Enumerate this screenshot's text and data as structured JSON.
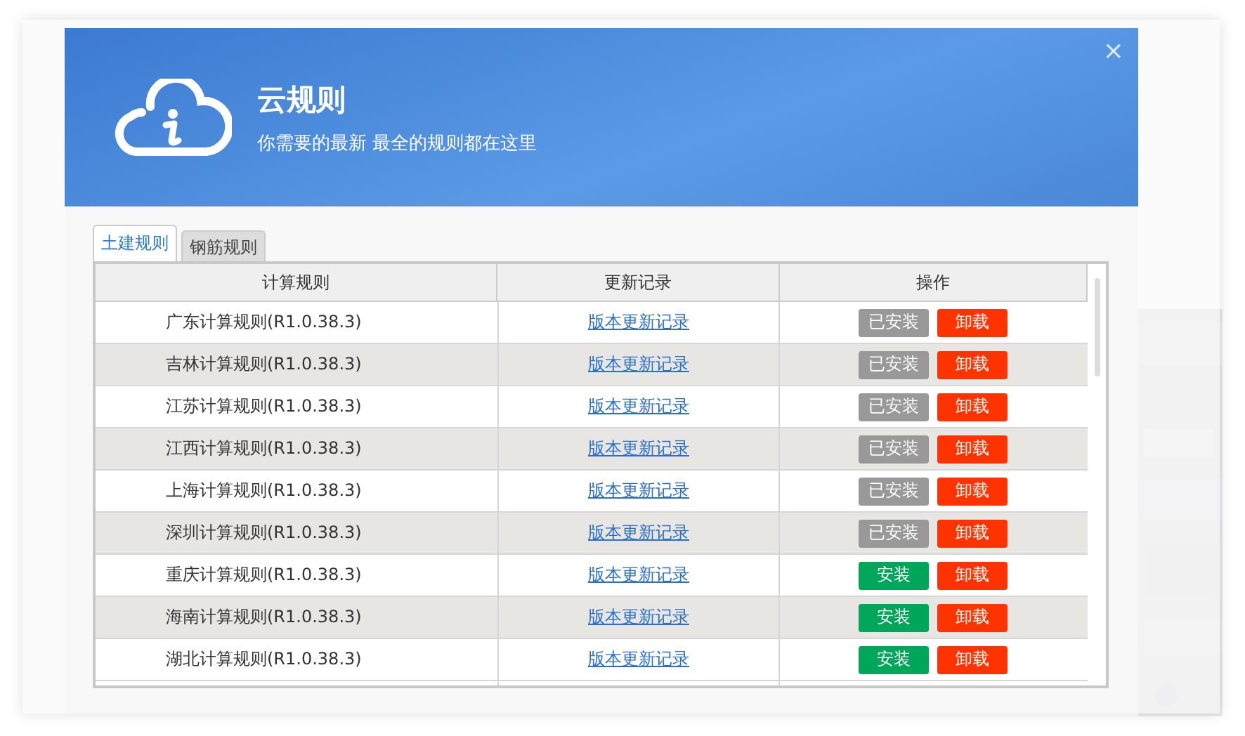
{
  "dialog": {
    "title": "云规则",
    "subtitle": "你需要的最新 最全的规则都在这里",
    "close": "×"
  },
  "tabs": [
    {
      "label": "土建规则",
      "selected": true
    },
    {
      "label": "钢筋规则",
      "selected": false
    }
  ],
  "table": {
    "columns": [
      "计算规则",
      "更新记录",
      "操作"
    ],
    "rows": [
      {
        "name": "广东计算规则(R1.0.38.3)",
        "link": "版本更新记录",
        "installed": true,
        "install": "已安装",
        "uninstall": "卸载"
      },
      {
        "name": "吉林计算规则(R1.0.38.3)",
        "link": "版本更新记录",
        "installed": true,
        "install": "已安装",
        "uninstall": "卸载"
      },
      {
        "name": "江苏计算规则(R1.0.38.3)",
        "link": "版本更新记录",
        "installed": true,
        "install": "已安装",
        "uninstall": "卸载"
      },
      {
        "name": "江西计算规则(R1.0.38.3)",
        "link": "版本更新记录",
        "installed": true,
        "install": "已安装",
        "uninstall": "卸载"
      },
      {
        "name": "上海计算规则(R1.0.38.3)",
        "link": "版本更新记录",
        "installed": true,
        "install": "已安装",
        "uninstall": "卸载"
      },
      {
        "name": "深圳计算规则(R1.0.38.3)",
        "link": "版本更新记录",
        "installed": true,
        "install": "已安装",
        "uninstall": "卸载"
      },
      {
        "name": "重庆计算规则(R1.0.38.3)",
        "link": "版本更新记录",
        "installed": false,
        "install": "安装",
        "uninstall": "卸载"
      },
      {
        "name": "海南计算规则(R1.0.38.3)",
        "link": "版本更新记录",
        "installed": false,
        "install": "安装",
        "uninstall": "卸载"
      },
      {
        "name": "湖北计算规则(R1.0.38.3)",
        "link": "版本更新记录",
        "installed": false,
        "install": "安装",
        "uninstall": "卸载"
      }
    ]
  }
}
